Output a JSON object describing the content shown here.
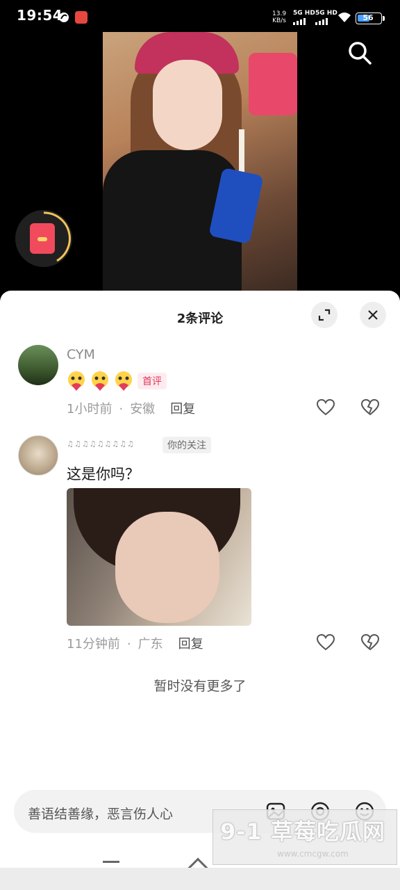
{
  "status_bar": {
    "time": "19:54",
    "net_speed_value": "13.9",
    "net_speed_unit": "KB/s",
    "sim1_label": "5G HD",
    "sim2_label": "5G HD",
    "battery": "56",
    "battery_level": 0.56,
    "icons": [
      "app-notification-icon",
      "app-redbook-icon",
      "signal-icon",
      "wifi-icon",
      "battery-icon"
    ]
  },
  "video": {
    "search_icon": "search-icon",
    "redpacket_icon": "red-packet-icon"
  },
  "comments_panel": {
    "title": "2条评论",
    "expand_icon": "expand-icon",
    "close_icon": "close-icon",
    "comments": [
      {
        "username": "CYM",
        "content_emojis": [
          "heart-face-emoji",
          "heart-face-emoji",
          "heart-face-emoji"
        ],
        "badge": "首评",
        "time": "1小时前",
        "dot": "·",
        "location": "安徽",
        "reply": "回复"
      },
      {
        "username": "♫♫♫♫♫♫♫♫♫",
        "badge": "你的关注",
        "text": "这是你吗？",
        "time": "11分钟前",
        "dot": "·",
        "location": "广东",
        "reply": "回复"
      }
    ],
    "no_more": "暂时没有更多了",
    "input_placeholder": "善语结善缘，恶言伤人心",
    "input_icons": [
      "image-icon",
      "mention-icon",
      "emoji-icon"
    ]
  },
  "watermark": {
    "main": "9-1 草莓吃瓜网",
    "sub": "www.cmcgw.com"
  },
  "colors": {
    "accent_red": "#e2395b",
    "sheet_bg": "#ffffff",
    "battery_fill": "#4aa3ff"
  }
}
